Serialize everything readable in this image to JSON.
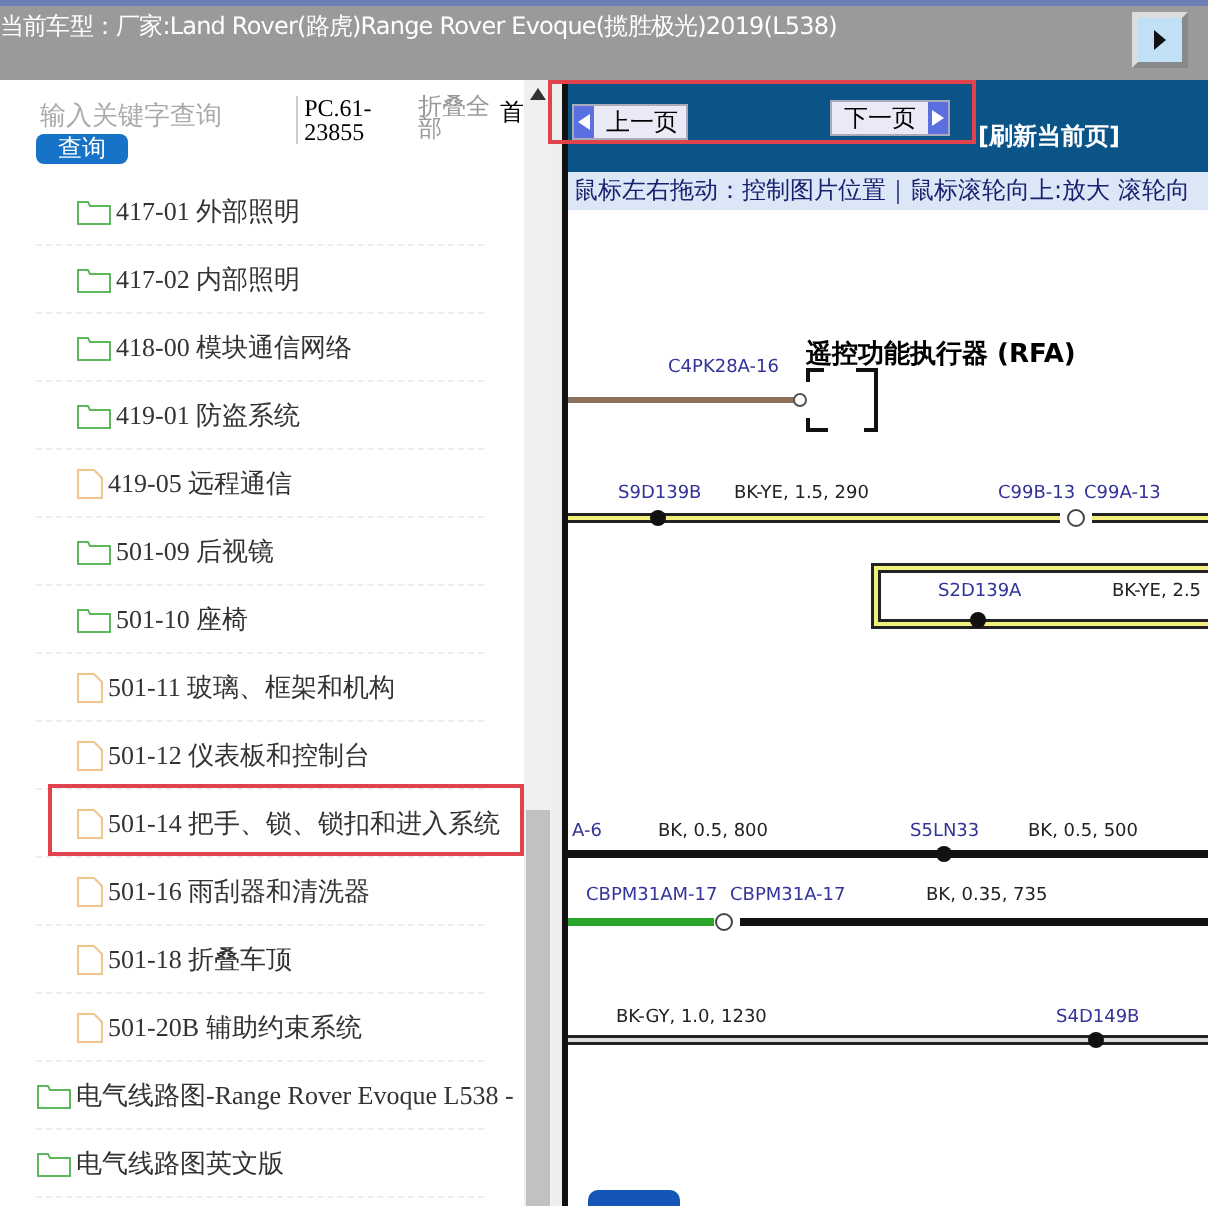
{
  "header": {
    "title": "当前车型：厂家:Land Rover(路虎)Range Rover Evoque(揽胜极光)2019(L538)"
  },
  "search": {
    "placeholder": "输入关键字查询",
    "button": "查询"
  },
  "toolbar": {
    "code": "PC.61-23855",
    "collapse": "折叠全部",
    "home": "首"
  },
  "tree": [
    {
      "children": [
        {
          "label": "417-01 外部照明",
          "kind": "folder",
          "highlighted": false
        },
        {
          "label": "417-02 内部照明",
          "kind": "folder",
          "highlighted": false
        },
        {
          "label": "418-00 模块通信网络",
          "kind": "folder",
          "highlighted": false
        },
        {
          "label": "419-01 防盗系统",
          "kind": "folder",
          "highlighted": false
        },
        {
          "label": "419-05 远程通信",
          "kind": "file",
          "highlighted": false
        },
        {
          "label": "501-09 后视镜",
          "kind": "folder",
          "highlighted": false
        },
        {
          "label": "501-10 座椅",
          "kind": "folder",
          "highlighted": false
        },
        {
          "label": "501-11 玻璃、框架和机构",
          "kind": "file",
          "highlighted": false
        },
        {
          "label": "501-12 仪表板和控制台",
          "kind": "file",
          "highlighted": false
        },
        {
          "label": "501-14 把手、锁、锁扣和进入系统",
          "kind": "file",
          "highlighted": true
        },
        {
          "label": "501-16 雨刮器和清洗器",
          "kind": "file",
          "highlighted": false
        },
        {
          "label": "501-18 折叠车顶",
          "kind": "file",
          "highlighted": false
        },
        {
          "label": "501-20B 辅助约束系统",
          "kind": "file",
          "highlighted": false
        }
      ]
    },
    {
      "label": "电气线路图-Range Rover Evoque L538 -",
      "kind": "folder",
      "highlighted": false
    },
    {
      "label": "电气线路图英文版",
      "kind": "folder",
      "highlighted": false
    }
  ],
  "pager": {
    "highlighted": true,
    "prev": "上一页",
    "next": "下一页",
    "refresh": "[刷新当前页]"
  },
  "hint": "鼠标左右拖动：控制图片位置｜鼠标滚轮向上:放大  滚轮向",
  "diagram": {
    "title": "遥控功能执行器 (RFA)",
    "labels": [
      {
        "text": "C4PK28A-16",
        "kind": "pin"
      },
      {
        "text": "S9D139B",
        "kind": "pin"
      },
      {
        "text": "BK-YE, 1.5, 290",
        "kind": "wire"
      },
      {
        "text": "C99B-13",
        "kind": "pin"
      },
      {
        "text": "C99A-13",
        "kind": "pin"
      },
      {
        "text": "S2D139A",
        "kind": "pin"
      },
      {
        "text": "BK-YE, 2.5",
        "kind": "wire"
      },
      {
        "text": "A-6",
        "kind": "pin"
      },
      {
        "text": "BK, 0.5, 800",
        "kind": "wire"
      },
      {
        "text": "S5LN33",
        "kind": "pin"
      },
      {
        "text": "BK, 0.5, 500",
        "kind": "wire"
      },
      {
        "text": "CBPM31AM-17",
        "kind": "pin"
      },
      {
        "text": "CBPM31A-17",
        "kind": "pin"
      },
      {
        "text": "BK, 0.35, 735",
        "kind": "wire"
      },
      {
        "text": "BK-GY, 1.0, 1230",
        "kind": "wire"
      },
      {
        "text": "S4D149B",
        "kind": "pin"
      }
    ]
  }
}
